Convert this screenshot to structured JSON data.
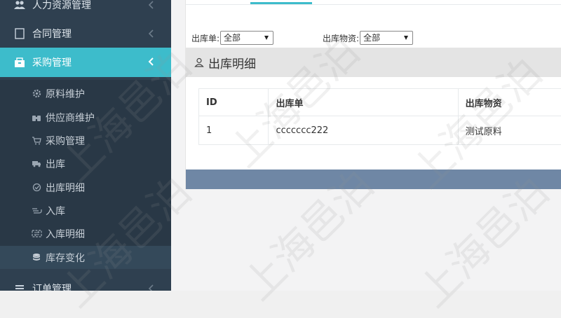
{
  "sidebar": {
    "items": [
      {
        "label": "人力资源管理",
        "icon": "users-icon"
      },
      {
        "label": "合同管理",
        "icon": "document-icon"
      },
      {
        "label": "采购管理",
        "icon": "basket-icon",
        "active": true
      },
      {
        "label": "订单管理",
        "icon": "list-icon"
      }
    ],
    "submenu": [
      {
        "label": "原料维护",
        "icon": "gear-icon"
      },
      {
        "label": "供应商维护",
        "icon": "binoculars-icon"
      },
      {
        "label": "采购管理",
        "icon": "cart-icon"
      },
      {
        "label": "出库",
        "icon": "truck-icon"
      },
      {
        "label": "出库明细",
        "icon": "check-circle-icon"
      },
      {
        "label": "入库",
        "icon": "hand-icon"
      },
      {
        "label": "入库明细",
        "icon": "exchange-icon"
      },
      {
        "label": "库存变化",
        "icon": "database-icon",
        "selected": true
      }
    ]
  },
  "filters": {
    "out_order_label": "出库单:",
    "out_order_value": "全部",
    "out_goods_label": "出库物资:",
    "out_goods_value": "全部"
  },
  "panel": {
    "title": "出库明细"
  },
  "table": {
    "headers": [
      "ID",
      "出库单",
      "出库物资"
    ],
    "rows": [
      [
        "1",
        "ccccccc222",
        "测试原料"
      ]
    ]
  },
  "watermark": "上海邑泊",
  "colors": {
    "accent": "#3dbccb",
    "sidebar": "#2f4050",
    "footer": "#6f87a5"
  }
}
